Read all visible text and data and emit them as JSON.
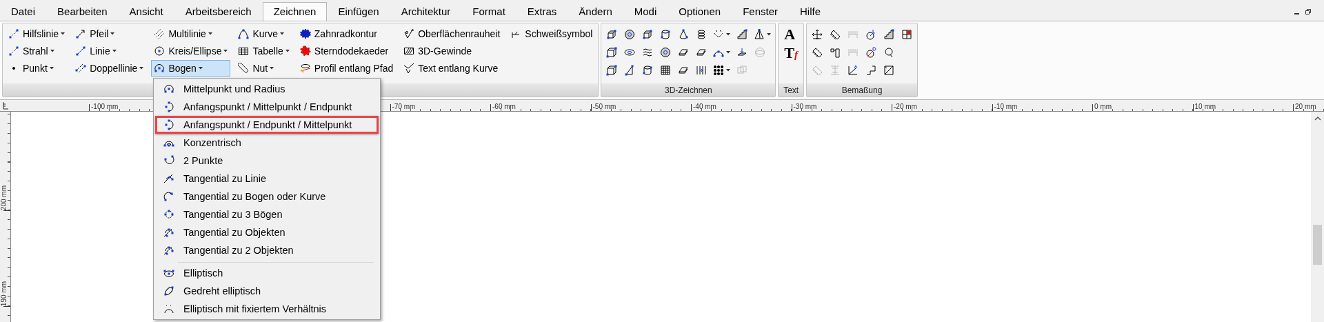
{
  "menu_bar": {
    "items": [
      {
        "label": "Datei",
        "selected": false
      },
      {
        "label": "Bearbeiten",
        "selected": false
      },
      {
        "label": "Ansicht",
        "selected": false
      },
      {
        "label": "Arbeitsbereich",
        "selected": false
      },
      {
        "label": "Zeichnen",
        "selected": true
      },
      {
        "label": "Einfügen",
        "selected": false
      },
      {
        "label": "Architektur",
        "selected": false
      },
      {
        "label": "Format",
        "selected": false
      },
      {
        "label": "Extras",
        "selected": false
      },
      {
        "label": "Ändern",
        "selected": false
      },
      {
        "label": "Modi",
        "selected": false
      },
      {
        "label": "Optionen",
        "selected": false
      },
      {
        "label": "Fenster",
        "selected": false
      },
      {
        "label": "Hilfe",
        "selected": false
      }
    ]
  },
  "ribbon": {
    "groups": [
      {
        "kind": "tools",
        "columns": [
          [
            {
              "label": "Hilfslinie",
              "has_menu": true,
              "selected": false
            },
            {
              "label": "Strahl",
              "has_menu": true,
              "selected": false
            },
            {
              "label": "Punkt",
              "has_menu": true,
              "selected": false
            }
          ],
          [
            {
              "label": "Pfeil",
              "has_menu": true,
              "selected": false
            },
            {
              "label": "Linie",
              "has_menu": true,
              "selected": false
            },
            {
              "label": "Doppellinie",
              "has_menu": true,
              "selected": false
            }
          ],
          [
            {
              "label": "Multilinie",
              "has_menu": true,
              "selected": false
            },
            {
              "label": "Kreis/Ellipse",
              "has_menu": true,
              "selected": false
            },
            {
              "label": "Bogen",
              "has_menu": true,
              "selected": true
            }
          ],
          [
            {
              "label": "Kurve",
              "has_menu": true,
              "selected": false
            },
            {
              "label": "Tabelle",
              "has_menu": true,
              "selected": false
            },
            {
              "label": "Nut",
              "has_menu": true,
              "selected": false
            }
          ],
          [
            {
              "label": "Zahnradkontur",
              "has_menu": false,
              "selected": false
            },
            {
              "label": "Sterndodekaeder",
              "has_menu": false,
              "selected": false
            },
            {
              "label": "Profil entlang Pfad",
              "has_menu": false,
              "selected": false
            }
          ],
          [
            {
              "label": "Oberflächenrauheit",
              "has_menu": false,
              "selected": false
            },
            {
              "label": "3D-Gewinde",
              "has_menu": false,
              "selected": false
            },
            {
              "label": "Text entlang Kurve",
              "has_menu": false,
              "selected": false
            }
          ],
          [
            {
              "label": "Schweißsymbol",
              "has_menu": false,
              "selected": false
            }
          ]
        ]
      },
      {
        "kind": "icons",
        "label": "3D-Zeichnen",
        "rows": [
          [
            {
              "has_menu": false,
              "disabled": false
            },
            {
              "has_menu": false,
              "disabled": false
            },
            {
              "has_menu": false,
              "disabled": false
            },
            {
              "has_menu": false,
              "disabled": false
            },
            {
              "has_menu": false,
              "disabled": false
            },
            {
              "has_menu": false,
              "disabled": false
            },
            {
              "has_menu": true,
              "disabled": false
            },
            {
              "has_menu": false,
              "disabled": false
            },
            {
              "has_menu": true,
              "disabled": false
            }
          ],
          [
            {
              "has_menu": false,
              "disabled": false
            },
            {
              "has_menu": false,
              "disabled": false
            },
            {
              "has_menu": false,
              "disabled": false
            },
            {
              "has_menu": false,
              "disabled": false
            },
            {
              "has_menu": false,
              "disabled": false
            },
            {
              "has_menu": false,
              "disabled": false
            },
            {
              "has_menu": true,
              "disabled": false
            },
            {
              "has_menu": false,
              "disabled": false
            },
            {
              "has_menu": false,
              "disabled": true
            }
          ],
          [
            {
              "has_menu": false,
              "disabled": false
            },
            {
              "has_menu": false,
              "disabled": false
            },
            {
              "has_menu": false,
              "disabled": false
            },
            {
              "has_menu": false,
              "disabled": false
            },
            {
              "has_menu": false,
              "disabled": false
            },
            {
              "has_menu": false,
              "disabled": false
            },
            {
              "has_menu": true,
              "disabled": false
            },
            {
              "has_menu": false,
              "disabled": true
            }
          ]
        ]
      },
      {
        "kind": "text",
        "label": "Text",
        "glyphs": [
          {
            "main": "A"
          },
          {
            "main": "T",
            "accent": "f"
          }
        ]
      },
      {
        "kind": "icons",
        "label": "Bemaßung",
        "rows": [
          [
            {
              "has_menu": false,
              "disabled": false
            },
            {
              "has_menu": false,
              "disabled": false
            },
            {
              "has_menu": false,
              "disabled": true
            },
            {
              "has_menu": false,
              "disabled": false
            },
            {
              "has_menu": false,
              "disabled": false
            },
            {
              "has_menu": false,
              "disabled": false
            }
          ],
          [
            {
              "has_menu": false,
              "disabled": false
            },
            {
              "has_menu": false,
              "disabled": false
            },
            {
              "has_menu": false,
              "disabled": true
            },
            {
              "has_menu": false,
              "disabled": false
            },
            {
              "has_menu": false,
              "disabled": false
            }
          ],
          [
            {
              "has_menu": false,
              "disabled": true
            },
            {
              "has_menu": false,
              "disabled": true
            },
            {
              "has_menu": false,
              "disabled": false
            },
            {
              "has_menu": false,
              "disabled": false
            },
            {
              "has_menu": false,
              "disabled": false
            }
          ]
        ]
      }
    ]
  },
  "horizontal_ruler": {
    "labels": [
      "-100 mm",
      "-70 mm",
      "-60 mm",
      "-50 mm",
      "-40 mm",
      "-30 mm",
      "-20 mm",
      "-10 mm",
      "0 mm",
      "10 mm",
      "20 mm"
    ]
  },
  "vertical_ruler": {
    "labels": [
      "200 mm",
      "190 mm"
    ]
  },
  "arc_menu": {
    "items": [
      {
        "label": "Mittelpunkt und Radius",
        "selected": false,
        "separator_before": false
      },
      {
        "label": "Anfangspunkt / Mittelpunkt / Endpunkt",
        "selected": false,
        "separator_before": false
      },
      {
        "label": "Anfangspunkt / Endpunkt / Mittelpunkt",
        "selected": true,
        "separator_before": false
      },
      {
        "label": "Konzentrisch",
        "selected": false,
        "separator_before": false
      },
      {
        "label": "2 Punkte",
        "selected": false,
        "separator_before": false
      },
      {
        "label": "Tangential zu Linie",
        "selected": false,
        "separator_before": false
      },
      {
        "label": "Tangential zu Bogen oder Kurve",
        "selected": false,
        "separator_before": false
      },
      {
        "label": "Tangential zu 3 Bögen",
        "selected": false,
        "separator_before": false
      },
      {
        "label": "Tangential zu Objekten",
        "selected": false,
        "separator_before": false
      },
      {
        "label": "Tangential zu 2 Objekten",
        "selected": false,
        "separator_before": false
      },
      {
        "label": "Elliptisch",
        "selected": false,
        "separator_before": true
      },
      {
        "label": "Gedreht elliptisch",
        "selected": false,
        "separator_before": false
      },
      {
        "label": "Elliptisch mit fixiertem Verhältnis",
        "selected": false,
        "separator_before": false
      }
    ]
  }
}
